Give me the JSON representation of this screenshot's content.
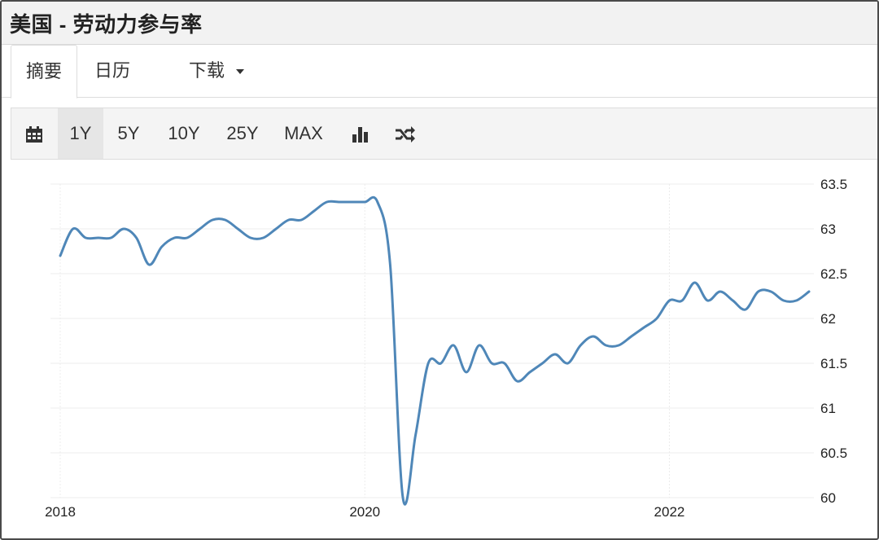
{
  "title": "美国 - 劳动力参与率",
  "tabs": [
    {
      "label": "摘要"
    },
    {
      "label": "日历"
    },
    {
      "label": "下载"
    }
  ],
  "toolbar": {
    "calendar_icon": "calendar-icon",
    "ranges": [
      "1Y",
      "5Y",
      "10Y",
      "25Y",
      "MAX"
    ],
    "active_range": "1Y",
    "bar_chart_icon": "bar-chart-icon",
    "shuffle_icon": "shuffle-icon"
  },
  "chart_data": {
    "type": "line",
    "title": "",
    "xlabel": "",
    "ylabel": "",
    "x_ticks": [
      "2018",
      "2020",
      "2022"
    ],
    "y_ticks": [
      "60",
      "60.5",
      "61",
      "61.5",
      "62",
      "62.5",
      "63",
      "63.5"
    ],
    "ylim": [
      60,
      63.5
    ],
    "xlim": [
      "2018-01",
      "2022-12"
    ],
    "grid": true,
    "line_color": "#4f87b8",
    "series": [
      {
        "x": [
          "2018-01",
          "2018-02",
          "2018-03",
          "2018-04",
          "2018-05",
          "2018-06",
          "2018-07",
          "2018-08",
          "2018-09",
          "2018-10",
          "2018-11",
          "2018-12",
          "2019-01",
          "2019-02",
          "2019-03",
          "2019-04",
          "2019-05",
          "2019-06",
          "2019-07",
          "2019-08",
          "2019-09",
          "2019-10",
          "2019-11",
          "2019-12",
          "2020-01",
          "2020-02",
          "2020-03",
          "2020-04",
          "2020-05",
          "2020-06",
          "2020-07",
          "2020-08",
          "2020-09",
          "2020-10",
          "2020-11",
          "2020-12",
          "2021-01",
          "2021-02",
          "2021-03",
          "2021-04",
          "2021-05",
          "2021-06",
          "2021-07",
          "2021-08",
          "2021-09",
          "2021-10",
          "2021-11",
          "2021-12",
          "2022-01",
          "2022-02",
          "2022-03",
          "2022-04",
          "2022-05",
          "2022-06",
          "2022-07",
          "2022-08",
          "2022-09",
          "2022-10",
          "2022-11",
          "2022-12"
        ],
        "values": [
          62.7,
          63.0,
          62.9,
          62.9,
          62.9,
          63.0,
          62.9,
          62.6,
          62.8,
          62.9,
          62.9,
          63.0,
          63.1,
          63.1,
          63.0,
          62.9,
          62.9,
          63.0,
          63.1,
          63.1,
          63.2,
          63.3,
          63.3,
          63.3,
          63.3,
          63.3,
          62.6,
          60.0,
          60.7,
          61.5,
          61.5,
          61.7,
          61.4,
          61.7,
          61.5,
          61.5,
          61.3,
          61.4,
          61.5,
          61.6,
          61.5,
          61.7,
          61.8,
          61.7,
          61.7,
          61.8,
          61.9,
          62.0,
          62.2,
          62.2,
          62.4,
          62.2,
          62.3,
          62.2,
          62.1,
          62.3,
          62.3,
          62.2,
          62.2,
          62.3
        ]
      }
    ]
  }
}
